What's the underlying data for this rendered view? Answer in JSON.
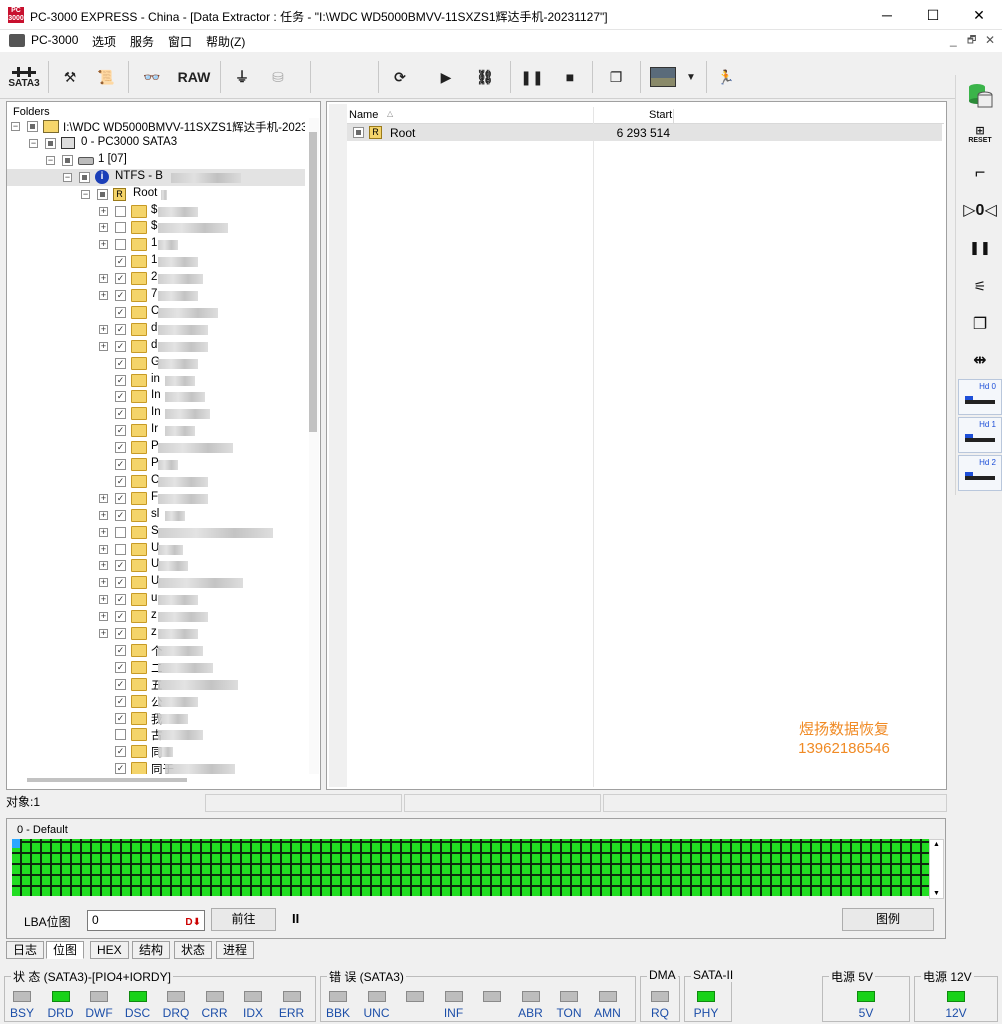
{
  "window": {
    "title": "PC-3000 EXPRESS - China - [Data Extractor : 任务 - \"I:\\WDC WD5000BMVV-11SXZS1辉达手机-20231127\"]",
    "icon_text": "PC 3000",
    "controls": [
      "minimize-icon",
      "maximize-icon",
      "close-icon"
    ]
  },
  "menu": {
    "items": [
      "PC-3000",
      "选项",
      "服务",
      "窗口",
      "帮助(Z)"
    ],
    "mdi_controls": [
      "_",
      "🗗",
      "✕"
    ]
  },
  "toolbar": {
    "sata_label": "SATA3",
    "raw_label": "RAW",
    "icons": [
      "sata-port-icon",
      "tools-icon",
      "scroll-icon",
      "binoculars-icon",
      "raw-icon",
      "sector-icon",
      "disk-icon",
      "refresh-icon",
      "play-icon",
      "tree-icon",
      "pause-icon",
      "stop-icon",
      "copy-icon",
      "image-icon",
      "dropdown-icon",
      "run-icon"
    ]
  },
  "right_toolbar": {
    "reset_label": "RESET",
    "hd_buttons": [
      "Hd 0",
      "Hd 1",
      "Hd 2"
    ]
  },
  "folders": {
    "title": "Folders",
    "tree": [
      {
        "level": 0,
        "exp": "−",
        "chk": "partial",
        "icon": "drive-multi-icon",
        "text": "I:\\WDC WD5000BMVV-11SXZS1辉达手机-2023"
      },
      {
        "level": 1,
        "exp": "−",
        "chk": "partial",
        "icon": "controller-icon",
        "text": "0 - PC3000 SATA3"
      },
      {
        "level": 2,
        "exp": "−",
        "chk": "partial",
        "icon": "hdd-icon",
        "text": "1 [07]"
      },
      {
        "level": 3,
        "exp": "−",
        "chk": "partial",
        "icon": "info-icon",
        "text": "NTFS - B",
        "selected": true,
        "blur": 70
      },
      {
        "level": 4,
        "exp": "−",
        "chk": "partial",
        "icon": "root-icon",
        "text": "Root",
        "blur": 6
      },
      {
        "level": 5,
        "exp": "+",
        "chk": "none",
        "text": "$",
        "blur": 40
      },
      {
        "level": 5,
        "exp": "+",
        "chk": "none",
        "text": "$",
        "blur": 70
      },
      {
        "level": 5,
        "exp": "+",
        "chk": "none",
        "text": "1",
        "blur": 20
      },
      {
        "level": 5,
        "exp": "",
        "chk": "check",
        "text": "1",
        "blur": 40
      },
      {
        "level": 5,
        "exp": "+",
        "chk": "check",
        "text": "2",
        "blur": 45
      },
      {
        "level": 5,
        "exp": "+",
        "chk": "check",
        "text": "7",
        "blur": 40
      },
      {
        "level": 5,
        "exp": "",
        "chk": "check",
        "text": "C",
        "blur": 60
      },
      {
        "level": 5,
        "exp": "+",
        "chk": "check",
        "text": "d",
        "blur": 50
      },
      {
        "level": 5,
        "exp": "+",
        "chk": "check",
        "text": "d",
        "blur": 50
      },
      {
        "level": 5,
        "exp": "",
        "chk": "check",
        "text": "G",
        "blur": 40
      },
      {
        "level": 5,
        "exp": "",
        "chk": "check",
        "text": "in",
        "blur": 30
      },
      {
        "level": 5,
        "exp": "",
        "chk": "check",
        "text": "In",
        "blur": 40
      },
      {
        "level": 5,
        "exp": "",
        "chk": "check",
        "text": "In",
        "blur": 45
      },
      {
        "level": 5,
        "exp": "",
        "chk": "check",
        "text": "Ir",
        "blur": 30
      },
      {
        "level": 5,
        "exp": "",
        "chk": "check",
        "text": "P",
        "blur": 75
      },
      {
        "level": 5,
        "exp": "",
        "chk": "check",
        "text": "P",
        "blur": 20
      },
      {
        "level": 5,
        "exp": "",
        "chk": "check",
        "text": "C",
        "blur": 50
      },
      {
        "level": 5,
        "exp": "+",
        "chk": "check",
        "text": "F",
        "blur": 50
      },
      {
        "level": 5,
        "exp": "+",
        "chk": "check",
        "text": "sl",
        "blur": 20
      },
      {
        "level": 5,
        "exp": "+",
        "chk": "none",
        "text": "S",
        "blur": 115
      },
      {
        "level": 5,
        "exp": "+",
        "chk": "none",
        "text": "U",
        "blur": 25
      },
      {
        "level": 5,
        "exp": "+",
        "chk": "check",
        "text": "U",
        "blur": 30
      },
      {
        "level": 5,
        "exp": "+",
        "chk": "check",
        "text": "U",
        "blur": 85
      },
      {
        "level": 5,
        "exp": "+",
        "chk": "check",
        "text": "u",
        "blur": 40
      },
      {
        "level": 5,
        "exp": "+",
        "chk": "check",
        "text": "z",
        "blur": 50
      },
      {
        "level": 5,
        "exp": "+",
        "chk": "check",
        "text": "z",
        "blur": 40
      },
      {
        "level": 5,
        "exp": "",
        "chk": "check",
        "text": "个",
        "blur": 45
      },
      {
        "level": 5,
        "exp": "",
        "chk": "check",
        "text": "二",
        "blur": 55
      },
      {
        "level": 5,
        "exp": "",
        "chk": "check",
        "text": "五",
        "blur": 80
      },
      {
        "level": 5,
        "exp": "",
        "chk": "check",
        "text": "公",
        "blur": 40
      },
      {
        "level": 5,
        "exp": "",
        "chk": "check",
        "text": "我",
        "blur": 30
      },
      {
        "level": 5,
        "exp": "",
        "chk": "none",
        "text": "古",
        "blur": 45
      },
      {
        "level": 5,
        "exp": "",
        "chk": "check",
        "text": "同",
        "blur": 15
      },
      {
        "level": 5,
        "exp": "",
        "chk": "check",
        "text": "同于",
        "blur": 70
      }
    ]
  },
  "files": {
    "columns": [
      "Name",
      "Start"
    ],
    "rows": [
      {
        "name": "Root",
        "start": "6 293 514"
      }
    ]
  },
  "watermark": {
    "line1": "煜扬数据恢复",
    "line2": "13962186546"
  },
  "status": {
    "objects": "对象:1"
  },
  "bitmap": {
    "label": "0 - Default",
    "lba_label": "LBA位图",
    "lba_value": "0",
    "goto_label": "前往",
    "pause_label": "II",
    "legend_label": "图例",
    "colors": {
      "filled": "#22dd22",
      "current": "#2da7ff",
      "background": "#0c0c0c"
    }
  },
  "bottom_tabs": [
    {
      "label": "日志",
      "active": false
    },
    {
      "label": "位图",
      "active": true
    },
    {
      "label": "HEX",
      "active": false
    },
    {
      "label": "结构",
      "active": false
    },
    {
      "label": "状态",
      "active": false
    },
    {
      "label": "进程",
      "active": false
    }
  ],
  "registers": {
    "status_title": "状 态 (SATA3)-[PIO4+IORDY]",
    "status_leds": [
      {
        "label": "BSY",
        "on": false
      },
      {
        "label": "DRD",
        "on": true
      },
      {
        "label": "DWF",
        "on": false
      },
      {
        "label": "DSC",
        "on": true
      },
      {
        "label": "DRQ",
        "on": false
      },
      {
        "label": "CRR",
        "on": false
      },
      {
        "label": "IDX",
        "on": false
      },
      {
        "label": "ERR",
        "on": false
      }
    ],
    "error_title": "错 误 (SATA3)",
    "error_leds": [
      {
        "label": "BBK",
        "on": false
      },
      {
        "label": "UNC",
        "on": false
      },
      {
        "label": "",
        "on": false
      },
      {
        "label": "INF",
        "on": false
      },
      {
        "label": "",
        "on": false
      },
      {
        "label": "ABR",
        "on": false
      },
      {
        "label": "TON",
        "on": false
      },
      {
        "label": "AMN",
        "on": false
      }
    ],
    "dma_title": "DMA",
    "dma_leds": [
      {
        "label": "RQ",
        "on": false
      }
    ],
    "sata_title": "SATA-II",
    "sata_leds": [
      {
        "label": "PHY",
        "on": true
      }
    ],
    "power5_title": "电源 5V",
    "power5_leds": [
      {
        "label": "5V",
        "on": true
      }
    ],
    "power12_title": "电源 12V",
    "power12_leds": [
      {
        "label": "12V",
        "on": true
      }
    ]
  }
}
